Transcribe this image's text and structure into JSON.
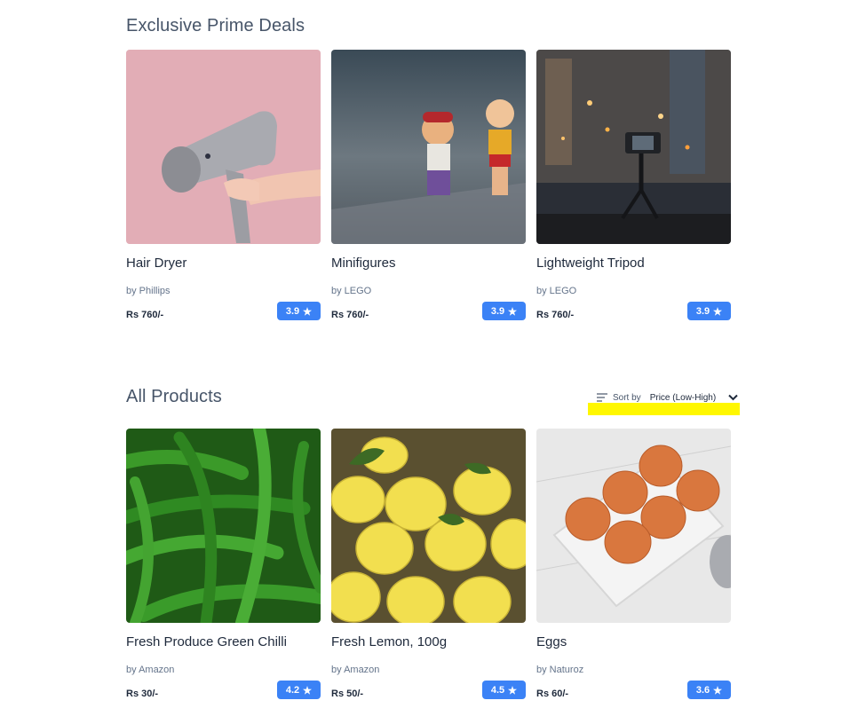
{
  "prime": {
    "title": "Exclusive Prime Deals",
    "products": [
      {
        "title": "Hair Dryer",
        "brand": "by Phillips",
        "price": "Rs 760/-",
        "rating": "3.9",
        "image": "hair-dryer-image"
      },
      {
        "title": "Minifigures",
        "brand": "by LEGO",
        "price": "Rs 760/-",
        "rating": "3.9",
        "image": "minifigures-image"
      },
      {
        "title": "Lightweight Tripod",
        "brand": "by LEGO",
        "price": "Rs 760/-",
        "rating": "3.9",
        "image": "tripod-image"
      }
    ]
  },
  "all_products": {
    "title": "All Products",
    "sort": {
      "label": "Sort by",
      "value": "Price (Low-High)"
    },
    "products": [
      {
        "title": "Fresh Produce Green Chilli",
        "brand": "by Amazon",
        "price": "Rs 30/-",
        "rating": "4.2",
        "image": "green-chilli-image"
      },
      {
        "title": "Fresh Lemon, 100g",
        "brand": "by Amazon",
        "price": "Rs 50/-",
        "rating": "4.5",
        "image": "lemon-image"
      },
      {
        "title": "Eggs",
        "brand": "by Naturoz",
        "price": "Rs 60/-",
        "rating": "3.6",
        "image": "eggs-image"
      }
    ]
  },
  "colors": {
    "accent": "#3b82f6",
    "highlight": "#fff700",
    "heading": "#475569"
  },
  "icons": {
    "rating": "star-icon",
    "sort": "sort-lines-icon",
    "dropdown": "chevron-down-icon"
  }
}
